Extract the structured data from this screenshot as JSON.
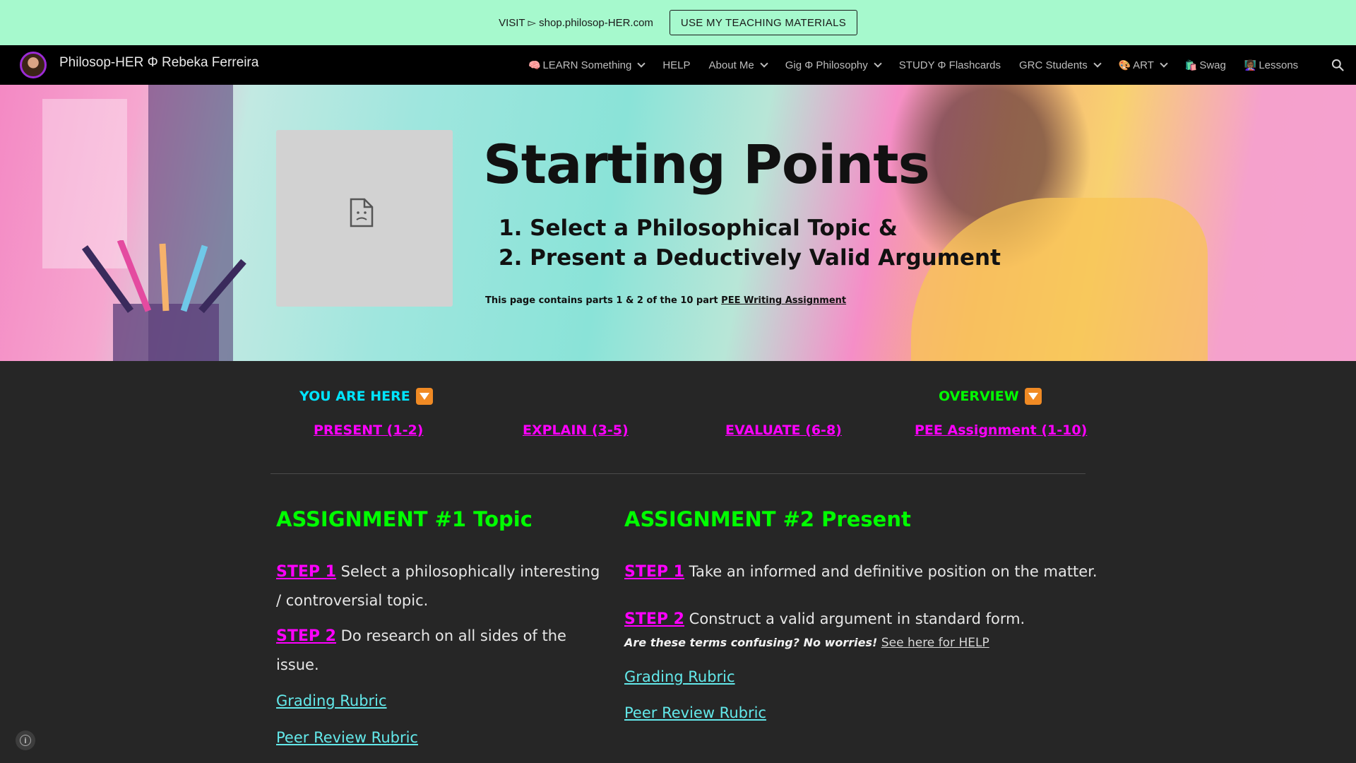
{
  "promo": {
    "text": "VISIT ▻ shop.philosop-HER.com",
    "button_label": "USE MY TEACHING MATERIALS"
  },
  "nav": {
    "site_title": "Philosop-HER Φ Rebeka Ferreira",
    "items": [
      {
        "label": "LEARN Something",
        "icon": "🧠",
        "has_dropdown": true
      },
      {
        "label": "HELP",
        "has_dropdown": false
      },
      {
        "label": "About Me",
        "has_dropdown": true
      },
      {
        "label": "Gig Φ Philosophy",
        "has_dropdown": true
      },
      {
        "label": "STUDY Φ Flashcards",
        "has_dropdown": false
      },
      {
        "label": "GRC Students",
        "has_dropdown": true
      },
      {
        "label": "ART",
        "icon": "🎨",
        "has_dropdown": true
      },
      {
        "label": "Swag",
        "icon": "🛍️",
        "has_dropdown": false
      },
      {
        "label": "Lessons",
        "icon": "👩🏾‍🏫",
        "has_dropdown": false
      }
    ],
    "search_icon": "search-icon"
  },
  "hero": {
    "title": "Starting Points",
    "list": [
      "1. Select a Philosophical Topic &",
      "2. Present a Deductively Valid Argument"
    ],
    "note_prefix": "This page contains parts 1 & 2 of the 10 part ",
    "note_link": "PEE Writing Assignment"
  },
  "sections": {
    "here_label": "YOU ARE HERE",
    "overview_label": "OVERVIEW",
    "links": [
      "PRESENT (1-2)",
      "EXPLAIN (3-5)",
      "EVALUATE (6-8)",
      "PEE Assignment (1-10)"
    ],
    "colors": {
      "here": "#00e5ff",
      "overview": "#00ff00",
      "link": "#ff00ff"
    }
  },
  "assignment1": {
    "heading": "ASSIGNMENT #1 Topic",
    "steps": [
      {
        "tag": "STEP 1",
        "text": " Select a philosophically interesting / controversial topic."
      },
      {
        "tag": "STEP 2",
        "text": " Do research on all sides of the issue."
      }
    ],
    "grading_rubric": "Grading Rubric",
    "peer_review_rubric": "Peer Review Rubric"
  },
  "assignment2": {
    "heading": "ASSIGNMENT #2 Present",
    "steps": [
      {
        "tag": "STEP 1",
        "text": " Take an informed and definitive position on the matter."
      },
      {
        "tag": "STEP 2",
        "text": " Construct a valid argument in standard form."
      }
    ],
    "confusing_text": "Are these terms confusing? No worries! ",
    "help_link": "See here for HELP",
    "grading_rubric": "Grading Rubric",
    "peer_review_rubric": "Peer Review Rubric"
  }
}
